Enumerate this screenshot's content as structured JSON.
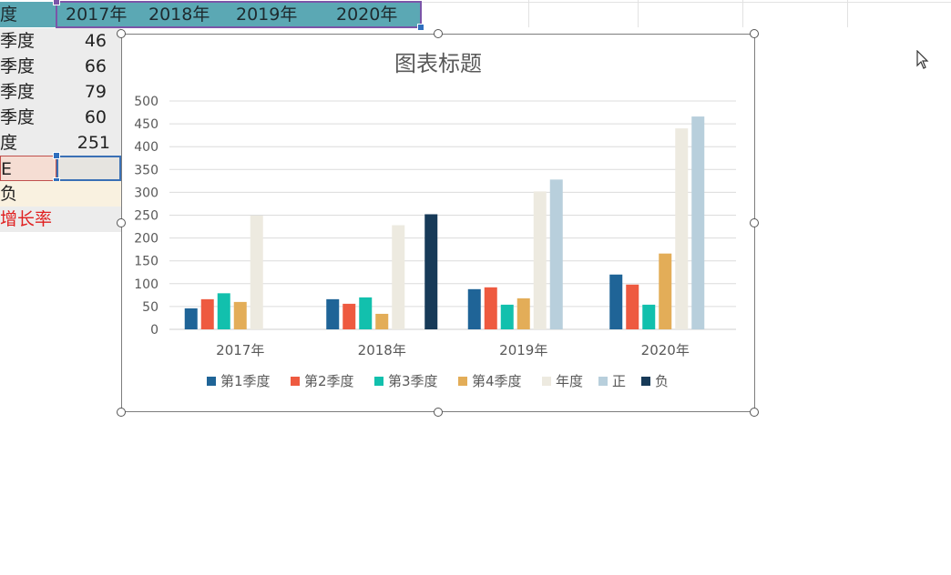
{
  "sheet": {
    "header_cell": "度",
    "year_headers": [
      "2017年",
      "2018年",
      "2019年",
      "2020年"
    ],
    "rows": [
      {
        "label": "季度",
        "value": "46"
      },
      {
        "label": "季度",
        "value": "66"
      },
      {
        "label": "季度",
        "value": "79"
      },
      {
        "label": "季度",
        "value": "60"
      },
      {
        "label": "度",
        "value": "251"
      },
      {
        "label": "E",
        "value": ""
      },
      {
        "label": "负",
        "value": ""
      },
      {
        "label": "增长率",
        "value": ""
      }
    ]
  },
  "colors": {
    "header_bg": "#5ba8b4",
    "selection_border": "#7b55a8",
    "row_e_bg": "#f5ddd3",
    "row_neg_bg": "#f9f1e0",
    "growth_text": "#e02020"
  },
  "chart_data": {
    "type": "bar",
    "title": "图表标题",
    "categories": [
      "2017年",
      "2018年",
      "2019年",
      "2020年"
    ],
    "ylim": [
      0,
      500
    ],
    "yticks": [
      "0",
      "50",
      "100",
      "150",
      "200",
      "250",
      "300",
      "350",
      "400",
      "450",
      "500"
    ],
    "grid": true,
    "legend_position": "bottom",
    "series": [
      {
        "name": "第1季度",
        "color": "#1f6497",
        "values": [
          46,
          66,
          88,
          120
        ]
      },
      {
        "name": "第2季度",
        "color": "#ee5a40",
        "values": [
          66,
          56,
          92,
          98
        ]
      },
      {
        "name": "第3季度",
        "color": "#12c0ad",
        "values": [
          79,
          70,
          54,
          54
        ]
      },
      {
        "name": "第4季度",
        "color": "#e3ad58",
        "values": [
          60,
          34,
          68,
          166
        ]
      },
      {
        "name": "年度",
        "color": "#edeae0",
        "values": [
          249,
          228,
          302,
          440
        ]
      },
      {
        "name": "正",
        "color": "#b8cfdc",
        "values": [
          null,
          null,
          328,
          466
        ]
      },
      {
        "name": "负",
        "color": "#173a58",
        "values": [
          null,
          252,
          null,
          null
        ]
      }
    ]
  }
}
